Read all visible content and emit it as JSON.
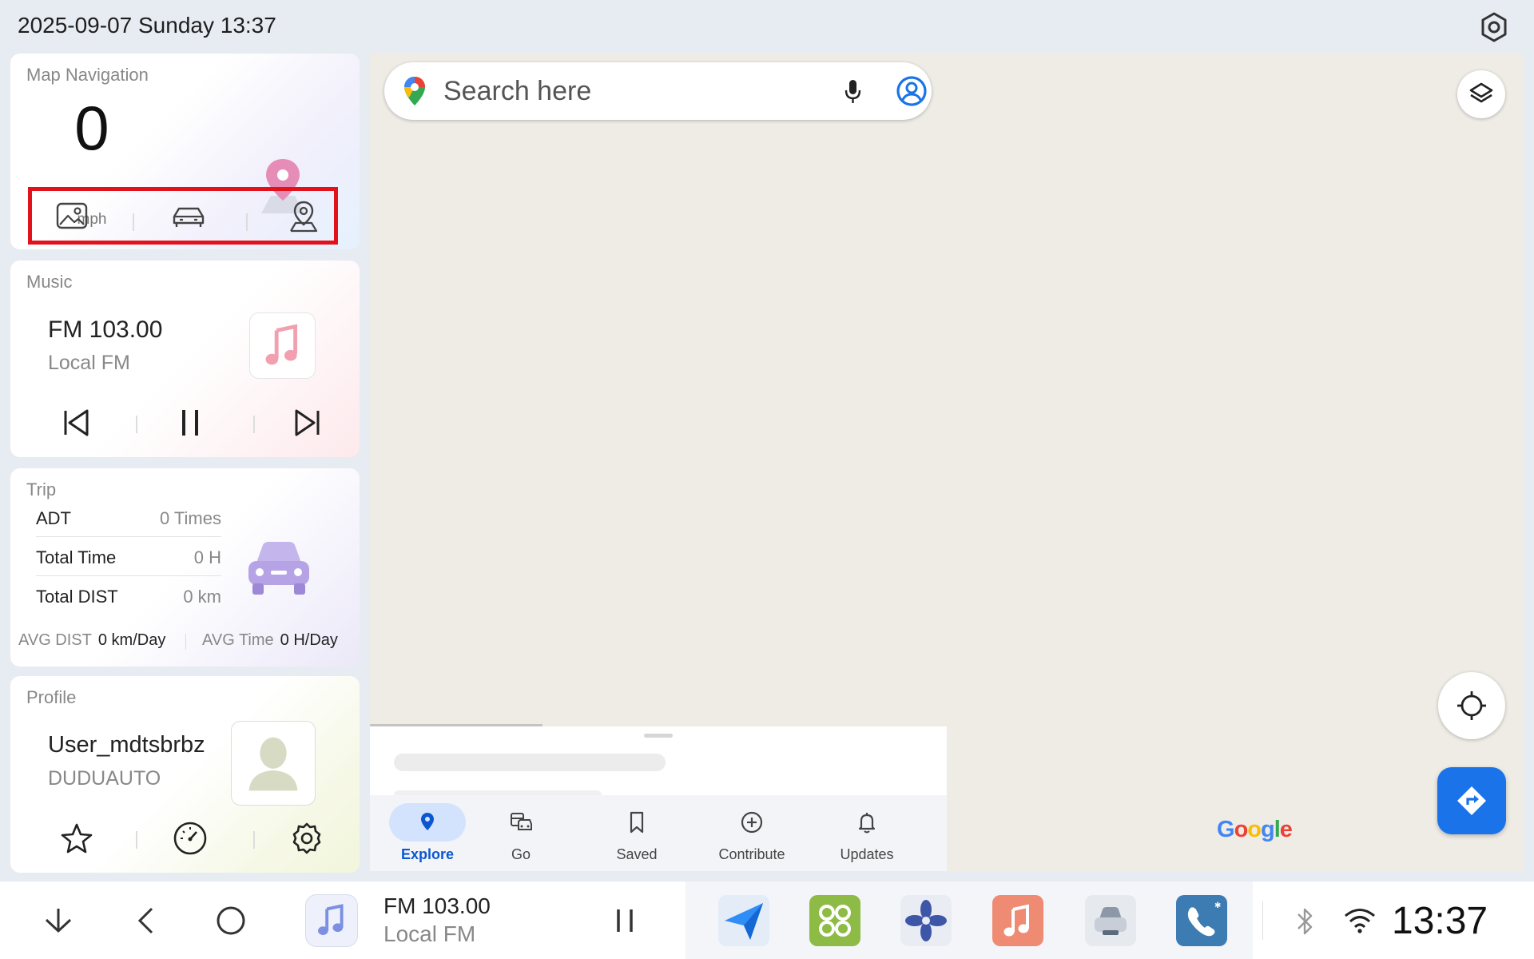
{
  "status_bar": {
    "datetime": "2025-09-07 Sunday 13:37",
    "settings_icon": "gear-icon"
  },
  "nav_card": {
    "title": "Map Navigation",
    "speed": "0",
    "unit": "mph",
    "actions": [
      "gallery-icon",
      "car-icon",
      "location-pin-icon"
    ]
  },
  "music_card": {
    "title": "Music",
    "station": "FM 103.00",
    "source": "Local FM",
    "controls": [
      "previous-icon",
      "pause-icon",
      "next-icon"
    ]
  },
  "trip_card": {
    "title": "Trip",
    "rows": [
      {
        "label": "ADT",
        "value": "0 Times"
      },
      {
        "label": "Total Time",
        "value": "0 H"
      },
      {
        "label": "Total DIST",
        "value": "0 km"
      }
    ],
    "avg_dist_label": "AVG DIST",
    "avg_dist_value": "0 km/Day",
    "avg_time_label": "AVG Time",
    "avg_time_value": "0 H/Day"
  },
  "profile_card": {
    "title": "Profile",
    "username": "User_mdtsbrbz",
    "org": "DUDUAUTO",
    "actions": [
      "star-icon",
      "speedometer-icon",
      "settings-icon"
    ]
  },
  "map": {
    "search_placeholder": "Search here",
    "logo": "Google",
    "logo_colors": [
      "#4285F4",
      "#EA4335",
      "#FBBC05",
      "#4285F4",
      "#34A853",
      "#EA4335"
    ],
    "tabs": [
      {
        "label": "Explore",
        "active": true
      },
      {
        "label": "Go",
        "active": false
      },
      {
        "label": "Saved",
        "active": false
      },
      {
        "label": "Contribute",
        "active": false
      },
      {
        "label": "Updates",
        "active": false
      }
    ],
    "accent": "#1a73e8"
  },
  "dock": {
    "station": "FM 103.00",
    "source": "Local FM",
    "clock": "13:37",
    "apps": [
      "navigation-app-icon",
      "apps-grid-icon",
      "fan-climate-icon",
      "music-app-icon",
      "car-app-icon",
      "phone-app-icon"
    ]
  }
}
